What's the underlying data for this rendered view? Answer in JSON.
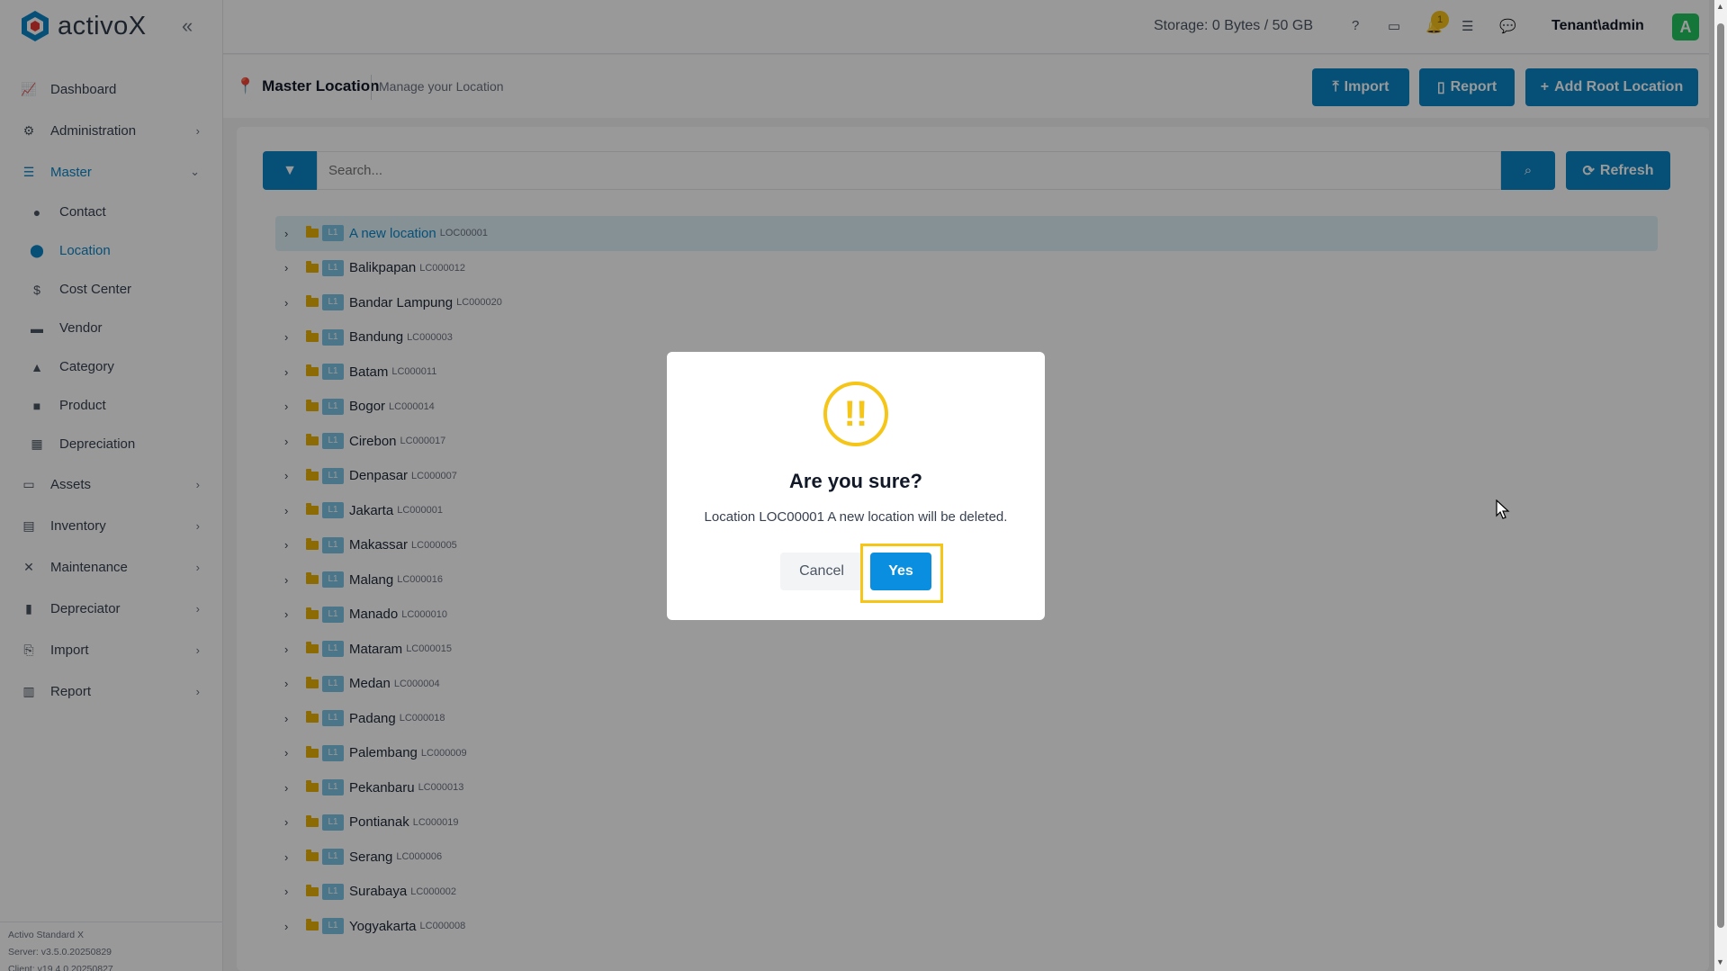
{
  "app": {
    "logo_text": "activoX",
    "storage": "Storage: 0 Bytes / 50 GB",
    "notification_count": "1",
    "user": "Tenant\\admin",
    "avatar_letter": "A",
    "brand_color": "#0a85c7"
  },
  "sidebar": {
    "items": [
      {
        "label": "Dashboard",
        "icon": "chart-line-icon"
      },
      {
        "label": "Administration",
        "icon": "cogs-icon"
      },
      {
        "label": "Master",
        "icon": "database-icon"
      },
      {
        "label": "Assets",
        "icon": "laptop-icon"
      },
      {
        "label": "Inventory",
        "icon": "warehouse-icon"
      },
      {
        "label": "Maintenance",
        "icon": "tools-icon"
      },
      {
        "label": "Depreciator",
        "icon": "clipboard-icon"
      },
      {
        "label": "Import",
        "icon": "file-import-icon"
      },
      {
        "label": "Report",
        "icon": "chart-bar-icon"
      }
    ],
    "master_sub": [
      {
        "label": "Contact",
        "icon": "user-icon"
      },
      {
        "label": "Location",
        "icon": "map-pin-icon"
      },
      {
        "label": "Cost Center",
        "icon": "dollar-icon"
      },
      {
        "label": "Vendor",
        "icon": "store-icon"
      },
      {
        "label": "Category",
        "icon": "shapes-icon"
      },
      {
        "label": "Product",
        "icon": "box-icon"
      },
      {
        "label": "Depreciation",
        "icon": "calculator-icon"
      }
    ],
    "footer": {
      "line1": "Activo Standard X",
      "line2": "Server: v3.5.0.20250829",
      "line3": "Client: v19.4.0.20250827"
    }
  },
  "page": {
    "title": "Master Location",
    "subtitle": "Manage your Location",
    "import_label": "Import",
    "report_label": "Report",
    "add_root_label": "Add Root Location",
    "search_placeholder": "Search...",
    "refresh_label": "Refresh"
  },
  "tree": {
    "level_badge": "L1",
    "rows": [
      {
        "name": "A new location",
        "code": "LOC00001"
      },
      {
        "name": "Balikpapan",
        "code": "LC000012"
      },
      {
        "name": "Bandar Lampung",
        "code": "LC000020"
      },
      {
        "name": "Bandung",
        "code": "LC000003"
      },
      {
        "name": "Batam",
        "code": "LC000011"
      },
      {
        "name": "Bogor",
        "code": "LC000014"
      },
      {
        "name": "Cirebon",
        "code": "LC000017"
      },
      {
        "name": "Denpasar",
        "code": "LC000007"
      },
      {
        "name": "Jakarta",
        "code": "LC000001"
      },
      {
        "name": "Makassar",
        "code": "LC000005"
      },
      {
        "name": "Malang",
        "code": "LC000016"
      },
      {
        "name": "Manado",
        "code": "LC000010"
      },
      {
        "name": "Mataram",
        "code": "LC000015"
      },
      {
        "name": "Medan",
        "code": "LC000004"
      },
      {
        "name": "Padang",
        "code": "LC000018"
      },
      {
        "name": "Palembang",
        "code": "LC000009"
      },
      {
        "name": "Pekanbaru",
        "code": "LC000013"
      },
      {
        "name": "Pontianak",
        "code": "LC000019"
      },
      {
        "name": "Serang",
        "code": "LC000006"
      },
      {
        "name": "Surabaya",
        "code": "LC000002"
      },
      {
        "name": "Yogyakarta",
        "code": "LC000008"
      }
    ]
  },
  "modal": {
    "icon": "!!",
    "title": "Are you sure?",
    "text": "Location LOC00001 A new location will be deleted.",
    "cancel_label": "Cancel",
    "yes_label": "Yes",
    "highlight_color": "#f5c518"
  }
}
